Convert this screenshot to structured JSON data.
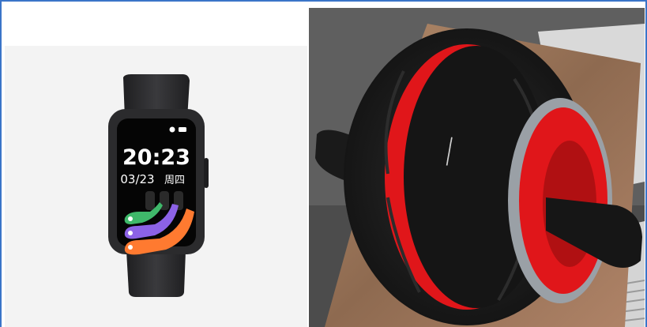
{
  "products": [
    {
      "kind": "smart-band",
      "screen": {
        "time": "20:23",
        "date": "03/23",
        "weekday": "周四"
      },
      "colors": {
        "band": "#2b2b2d",
        "ring_green": "#3fb86a",
        "ring_purple": "#8c62e6",
        "ring_orange": "#ff7a30"
      }
    },
    {
      "kind": "ab-roller",
      "colors": {
        "tire": "#1c1c1c",
        "accent": "#e0161a",
        "wood": "#a57c5e"
      }
    }
  ]
}
